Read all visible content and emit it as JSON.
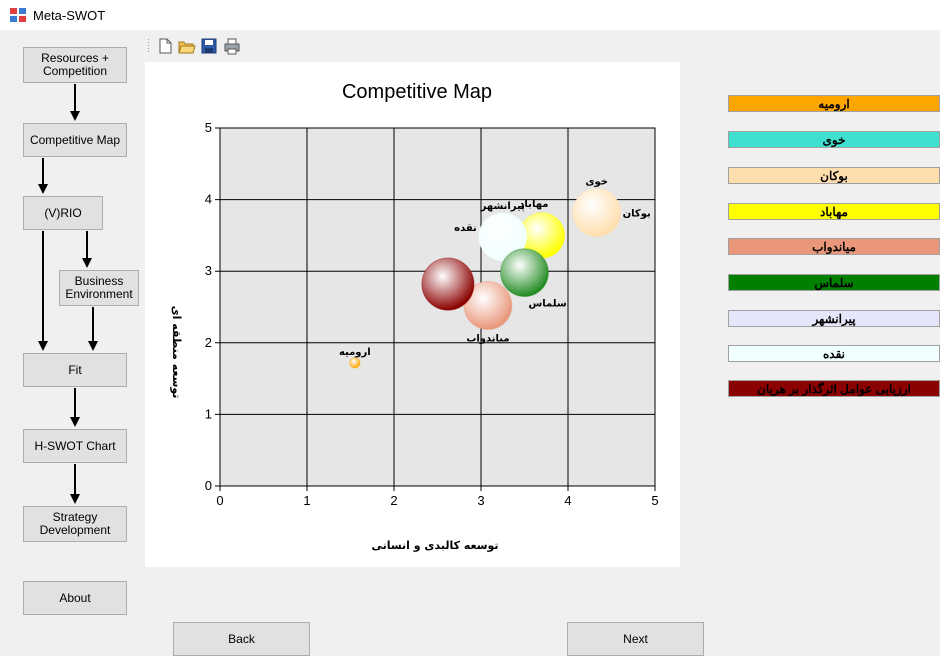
{
  "window": {
    "title": "Meta-SWOT"
  },
  "nav": {
    "resources": "Resources +\nCompetition",
    "competitive_map": "Competitive Map",
    "vrio": "(V)RIO",
    "business_env": "Business\nEnvironment",
    "fit": "Fit",
    "hswot": "H-SWOT Chart",
    "strategy": "Strategy\nDevelopment",
    "about": "About"
  },
  "footer": {
    "back": "Back",
    "next": "Next"
  },
  "toolbar": {
    "icons": [
      "new-file-icon",
      "open-folder-icon",
      "save-icon",
      "print-icon"
    ]
  },
  "legend": [
    {
      "label": "ارومیه",
      "color": "#FFA500"
    },
    {
      "label": "خوی",
      "color": "#40E0D0"
    },
    {
      "label": "بوکان",
      "color": "#FFDEAD"
    },
    {
      "label": "مهاباد",
      "color": "#FFFF00"
    },
    {
      "label": "میاندواب",
      "color": "#E9967A"
    },
    {
      "label": "سلماس",
      "color": "#008000"
    },
    {
      "label": "پیرانشهر",
      "color": "#E6E6FA"
    },
    {
      "label": "نقده",
      "color": "#F0FFFF"
    },
    {
      "label": "ارزیابی عوامل اثرگذار بر هریان",
      "color": "#8B0000"
    }
  ],
  "chart_data": {
    "type": "scatter",
    "title": "Competitive Map",
    "xlabel": "توسعه کالبدی و انسانی",
    "ylabel": "توسعه منطقه ای",
    "xlim": [
      0,
      5
    ],
    "ylim": [
      0,
      5
    ],
    "x_ticks": [
      "0",
      "1",
      "2",
      "3",
      "4",
      "5"
    ],
    "y_ticks": [
      "0",
      "1",
      "2",
      "3",
      "4",
      "5"
    ],
    "grid": true,
    "points": [
      {
        "label": "ارومیه",
        "x": 1.55,
        "y": 1.72,
        "size": 0.12,
        "color": "#FFA500"
      },
      {
        "label": "خوی",
        "x": 4.33,
        "y": 3.82,
        "size": 0.55,
        "color": "#FFDEAD"
      },
      {
        "label": "بوکان",
        "x": 4.33,
        "y": 3.82,
        "size": 0.55,
        "color": "#FFDEAD"
      },
      {
        "label": "مهاباد",
        "x": 3.7,
        "y": 3.5,
        "size": 0.52,
        "color": "#FFFF00"
      },
      {
        "label": "پیرانشهر",
        "x": 3.25,
        "y": 3.48,
        "size": 0.55,
        "color": "#F0FFFF"
      },
      {
        "label": "نقده",
        "x": 3.25,
        "y": 3.48,
        "size": 0.55,
        "color": "#F0FFFF"
      },
      {
        "label": "سلماس",
        "x": 3.5,
        "y": 2.98,
        "size": 0.55,
        "color": "#228B22"
      },
      {
        "label": "میاندواب",
        "x": 3.08,
        "y": 2.52,
        "size": 0.55,
        "color": "#E9967A"
      },
      {
        "label": "",
        "x": 2.62,
        "y": 2.82,
        "size": 0.6,
        "color": "#8B0000"
      }
    ]
  }
}
